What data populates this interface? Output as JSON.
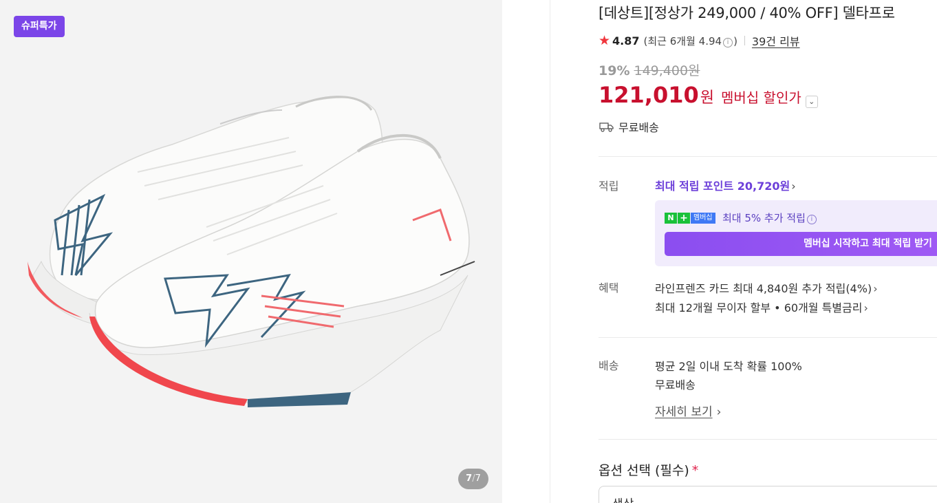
{
  "gallery": {
    "badge": "슈퍼특가",
    "counter_current": "7",
    "counter_sep": "/",
    "counter_total": "7"
  },
  "product": {
    "title": "[데상트][정상가 249,000 / 40% OFF] 델타프로",
    "rating": "4.87",
    "recent_prefix": "(최근 6개월 4.94",
    "recent_suffix": ")",
    "reviews": "39건 리뷰",
    "discount_rate": "19%",
    "original_price": "149,400원",
    "price": "121,010",
    "price_unit": "원",
    "price_label": "멤버십 할인가",
    "shipping": "무료배송"
  },
  "points": {
    "label": "적립",
    "link": "최대 적립 포인트 20,720원",
    "npay_n": "N",
    "npay_plus": "+",
    "npay_membership": "멤버십",
    "member_text": "최대 5% 추가 적립",
    "member_button": "멤버십 시작하고 최대 적립 받기"
  },
  "benefits": {
    "label": "혜택",
    "items": [
      "라인프렌즈 카드 최대 4,840원 추가 적립(4%)",
      "최대 12개월 무이자 할부 • 60개월 특별금리"
    ]
  },
  "delivery": {
    "label": "배송",
    "line1": "평균 2일 이내 도착 확률 100%",
    "line2": "무료배송",
    "detail_link": "자세히 보기"
  },
  "options": {
    "title": "옵션 선택 (필수)",
    "required_mark": "*",
    "select_value": "색상"
  },
  "colors": {
    "brand_purple": "#7b45e8",
    "price_red": "#c8102e",
    "star_red": "#f0363d",
    "npay_green": "#19c13a"
  }
}
